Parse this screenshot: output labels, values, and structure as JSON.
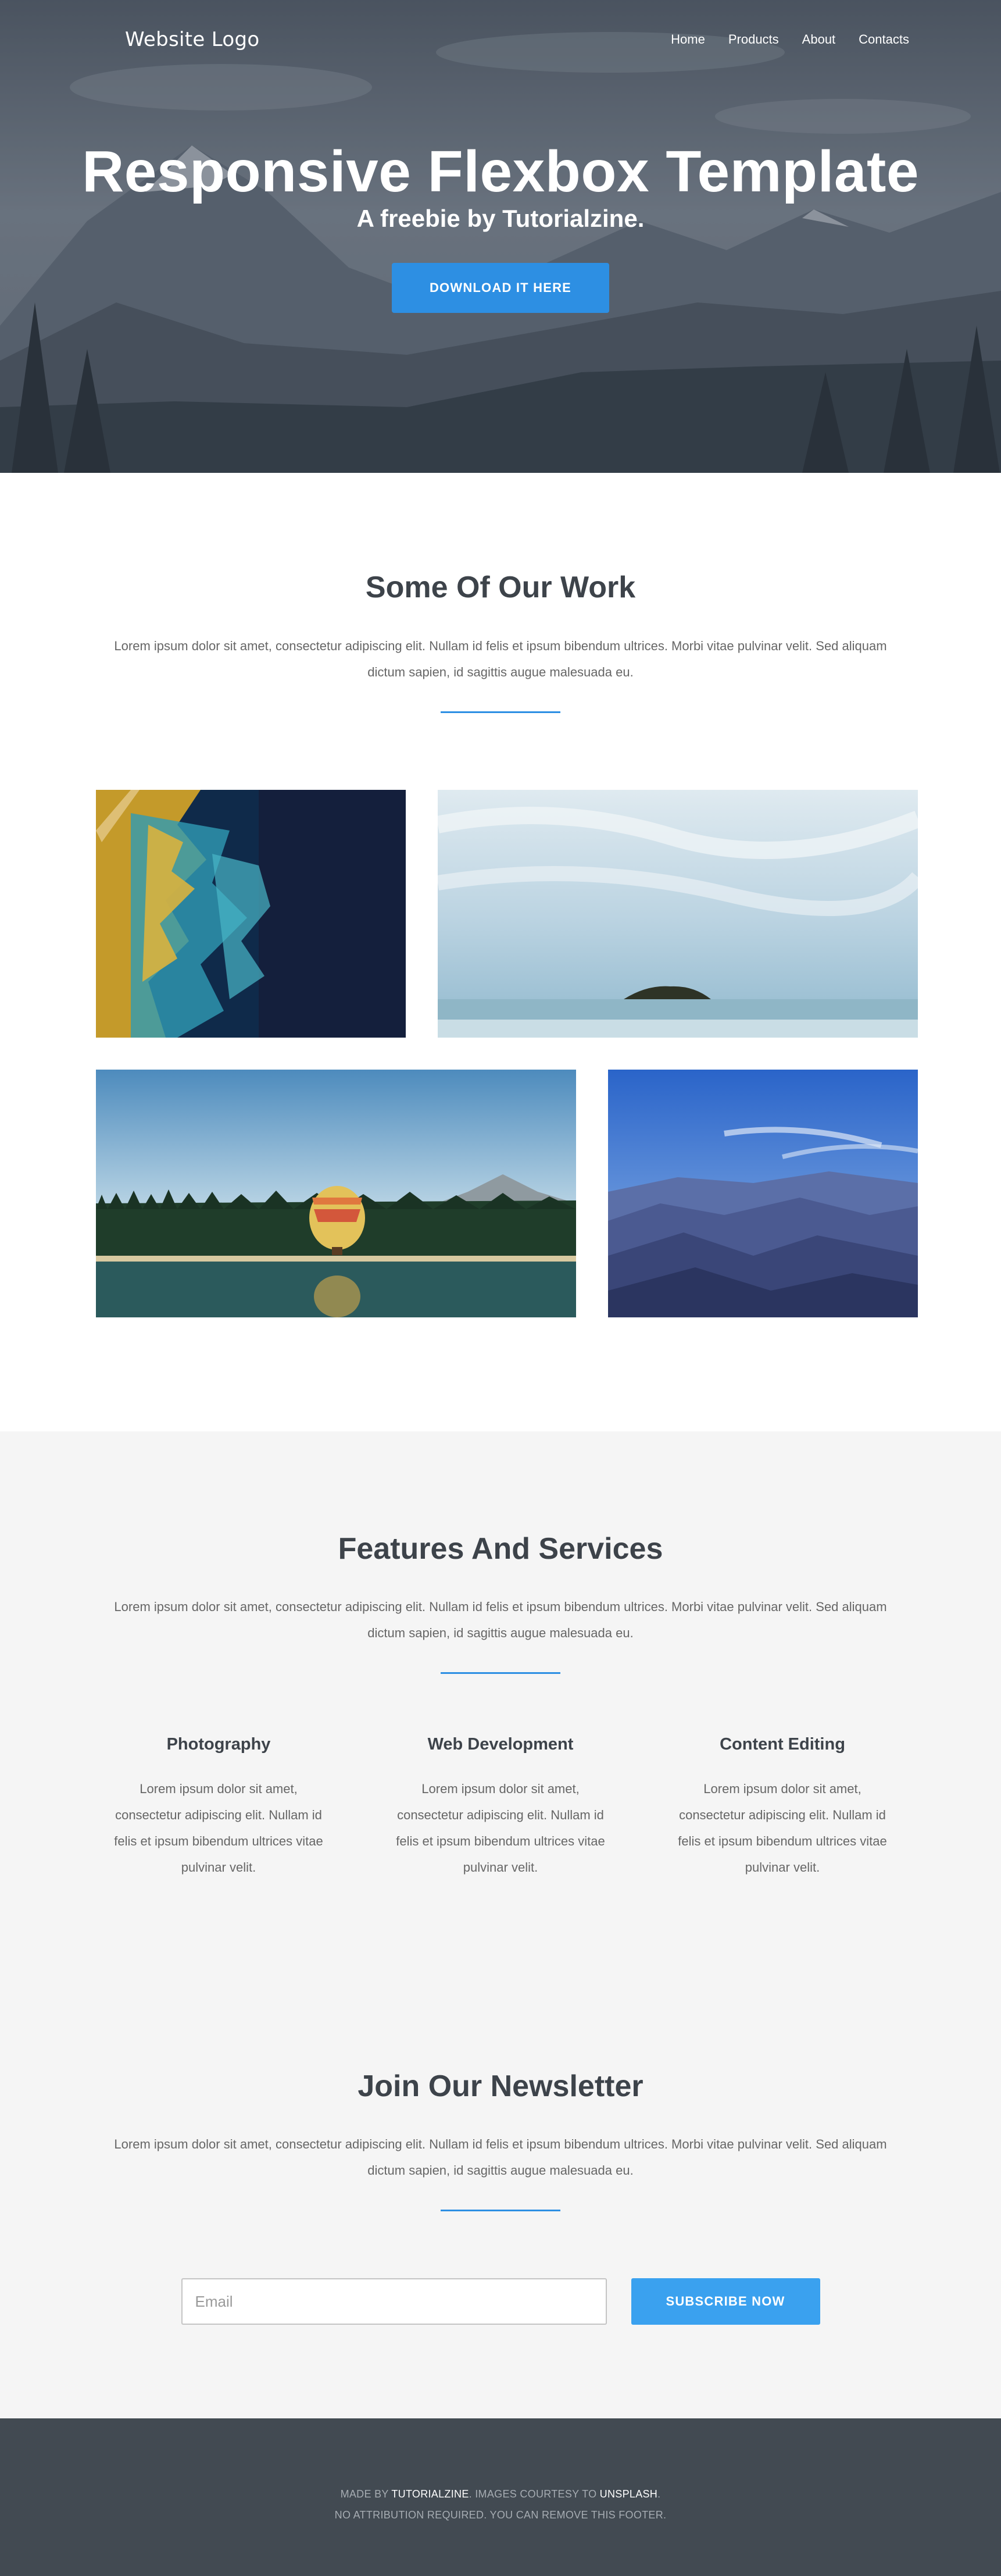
{
  "header": {
    "logo": "Website Logo",
    "nav": [
      {
        "label": "Home"
      },
      {
        "label": "Products"
      },
      {
        "label": "About"
      },
      {
        "label": "Contacts"
      }
    ]
  },
  "hero": {
    "title": "Responsive Flexbox Template",
    "subtitle": "A freebie by Tutorialzine.",
    "cta": "DOWNLOAD IT HERE"
  },
  "work": {
    "title": "Some Of Our Work",
    "text": "Lorem ipsum dolor sit amet, consectetur adipiscing elit. Nullam id felis et ipsum bibendum ultrices. Morbi vitae pulvinar velit. Sed aliquam dictum sapien, id sagittis augue malesuada eu."
  },
  "features": {
    "title": "Features And Services",
    "text": "Lorem ipsum dolor sit amet, consectetur adipiscing elit. Nullam id felis et ipsum bibendum ultrices. Morbi vitae pulvinar velit. Sed aliquam dictum sapien, id sagittis augue malesuada eu.",
    "items": [
      {
        "title": "Photography",
        "text": "Lorem ipsum dolor sit amet, consectetur adipiscing elit. Nullam id felis et ipsum bibendum ultrices vitae pulvinar velit."
      },
      {
        "title": "Web Development",
        "text": "Lorem ipsum dolor sit amet, consectetur adipiscing elit. Nullam id felis et ipsum bibendum ultrices vitae pulvinar velit."
      },
      {
        "title": "Content Editing",
        "text": "Lorem ipsum dolor sit amet, consectetur adipiscing elit. Nullam id felis et ipsum bibendum ultrices vitae pulvinar velit."
      }
    ]
  },
  "newsletter": {
    "title": "Join Our Newsletter",
    "text": "Lorem ipsum dolor sit amet, consectetur adipiscing elit. Nullam id felis et ipsum bibendum ultrices. Morbi vitae pulvinar velit. Sed aliquam dictum sapien, id sagittis augue malesuada eu.",
    "email_placeholder": "Email",
    "subscribe": "SUBSCRIBE NOW"
  },
  "footer": {
    "made_by_prefix": "MADE BY ",
    "made_by_link": "TUTORIALZINE",
    "images_prefix": ". IMAGES COURTESY TO ",
    "images_link": "UNSPLASH",
    "period": ".",
    "line2": "NO ATTRIBUTION REQUIRED. YOU CAN REMOVE THIS FOOTER."
  },
  "colors": {
    "accent": "#2d8fe3",
    "subscribe": "#3aa1ef",
    "footer_bg": "#424a52",
    "section_bg": "#f5f5f5",
    "heading": "#3d434a"
  }
}
